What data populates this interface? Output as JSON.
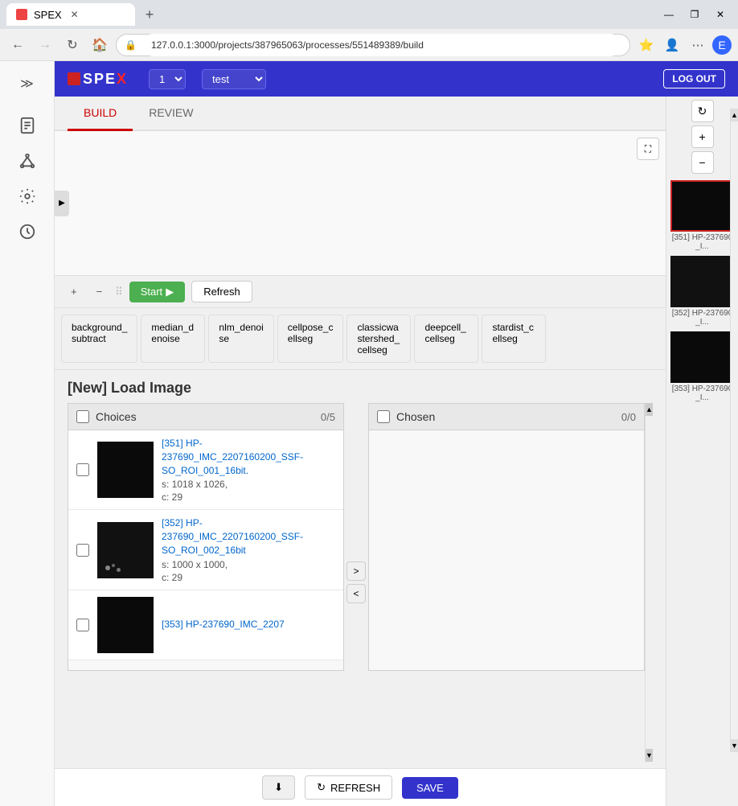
{
  "browser": {
    "tab_label": "SPEX",
    "url": "127.0.0.1:3000/projects/387965063/processes/551489389/build",
    "window_min": "—",
    "window_max": "❐",
    "window_close": "✕"
  },
  "header": {
    "logo": "SPEX",
    "version": "1",
    "project": "test",
    "logout": "LOG OUT"
  },
  "tabs": {
    "build": "BUILD",
    "review": "REVIEW"
  },
  "toolbar": {
    "plus": "+",
    "minus": "−",
    "drag": "⠿",
    "start": "Start",
    "refresh": "Refresh"
  },
  "nodes": [
    {
      "label": "background_subtract"
    },
    {
      "label": "median_denoise"
    },
    {
      "label": "nlm_denoise"
    },
    {
      "label": "cellpose_cellseg"
    },
    {
      "label": "classicwstershed_cellseg"
    },
    {
      "label": "deepcell_cellseg"
    },
    {
      "label": "stardist_cellseg"
    }
  ],
  "section_title": "[New] Load Image",
  "choices_panel": {
    "title": "Choices",
    "count": "0/5"
  },
  "chosen_panel": {
    "title": "Chosen",
    "count": "0/0"
  },
  "items": [
    {
      "id": "[351]",
      "name": "HP-237690_IMC_2207160200_SSF-SO_ROI_001_16bit.",
      "size": "s: 1018 x 1026,",
      "channels": "c: 29"
    },
    {
      "id": "[352]",
      "name": "HP-237690_IMC_2207160200_SSF-SO_ROI_002_16bit",
      "size": "s: 1000 x 1000,",
      "channels": "c: 29"
    },
    {
      "id": "[353]",
      "name": "HP-237690_IMC_2207",
      "size": "",
      "channels": ""
    }
  ],
  "right_panel": {
    "items": [
      {
        "label": "[351] HP-237690_I...",
        "selected": true
      },
      {
        "label": "[352] HP-237690_I...",
        "selected": false
      },
      {
        "label": "[353] HP-237690_I...",
        "selected": false
      }
    ]
  },
  "bottom_bar": {
    "download": "⬇",
    "refresh": "↻ REFRESH",
    "save": "SAVE"
  },
  "sidebar_icons": [
    "≫",
    "📄",
    "⬡",
    "⚙",
    "🔄"
  ]
}
